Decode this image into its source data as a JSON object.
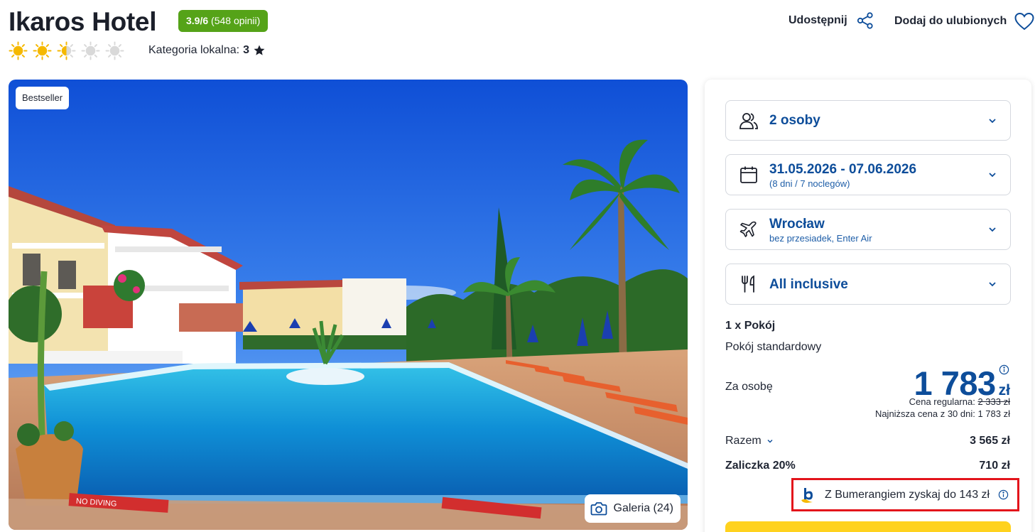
{
  "header": {
    "title": "Ikaros Hotel",
    "rating_score": "3.9/6",
    "rating_count": "(548 opinii)",
    "suns_total": 5,
    "suns_filled": 2.5,
    "local_category_label": "Kategoria lokalna:",
    "local_category_value": "3",
    "share_label": "Udostępnij",
    "favorites_label": "Dodaj do ulubionych"
  },
  "photo": {
    "badge": "Bestseller",
    "gallery_label": "Galeria (24)",
    "sign_text": "NO DIVING"
  },
  "booking": {
    "travelers": {
      "label": "2 osoby"
    },
    "dates": {
      "label": "31.05.2026 - 07.06.2026",
      "sub": "(8 dni / 7 noclegów)"
    },
    "flight": {
      "label": "Wrocław",
      "sub": "bez przesiadek, Enter Air"
    },
    "board": {
      "label": "All inclusive"
    },
    "room_count": "1 x Pokój",
    "room_type": "Pokój standardowy",
    "per_person_label": "Za osobę",
    "price_value": "1 783",
    "price_currency": "zł",
    "regular_price_label": "Cena regularna:",
    "regular_price_value": "2 333 zł",
    "lowest_30d": "Najniższa cena z 30 dni: 1 783 zł",
    "total_label": "Razem",
    "total_value": "3 565 zł",
    "deposit_label": "Zaliczka 20%",
    "deposit_value": "710 zł",
    "bumerang_text": "Z Bumerangiem zyskaj do 143 zł"
  },
  "colors": {
    "brand_blue": "#0d4d9a",
    "rating_green": "#55a318",
    "highlight_red": "#e3141b",
    "cta_yellow": "#ffd21e",
    "sun_yellow": "#f5b800"
  }
}
